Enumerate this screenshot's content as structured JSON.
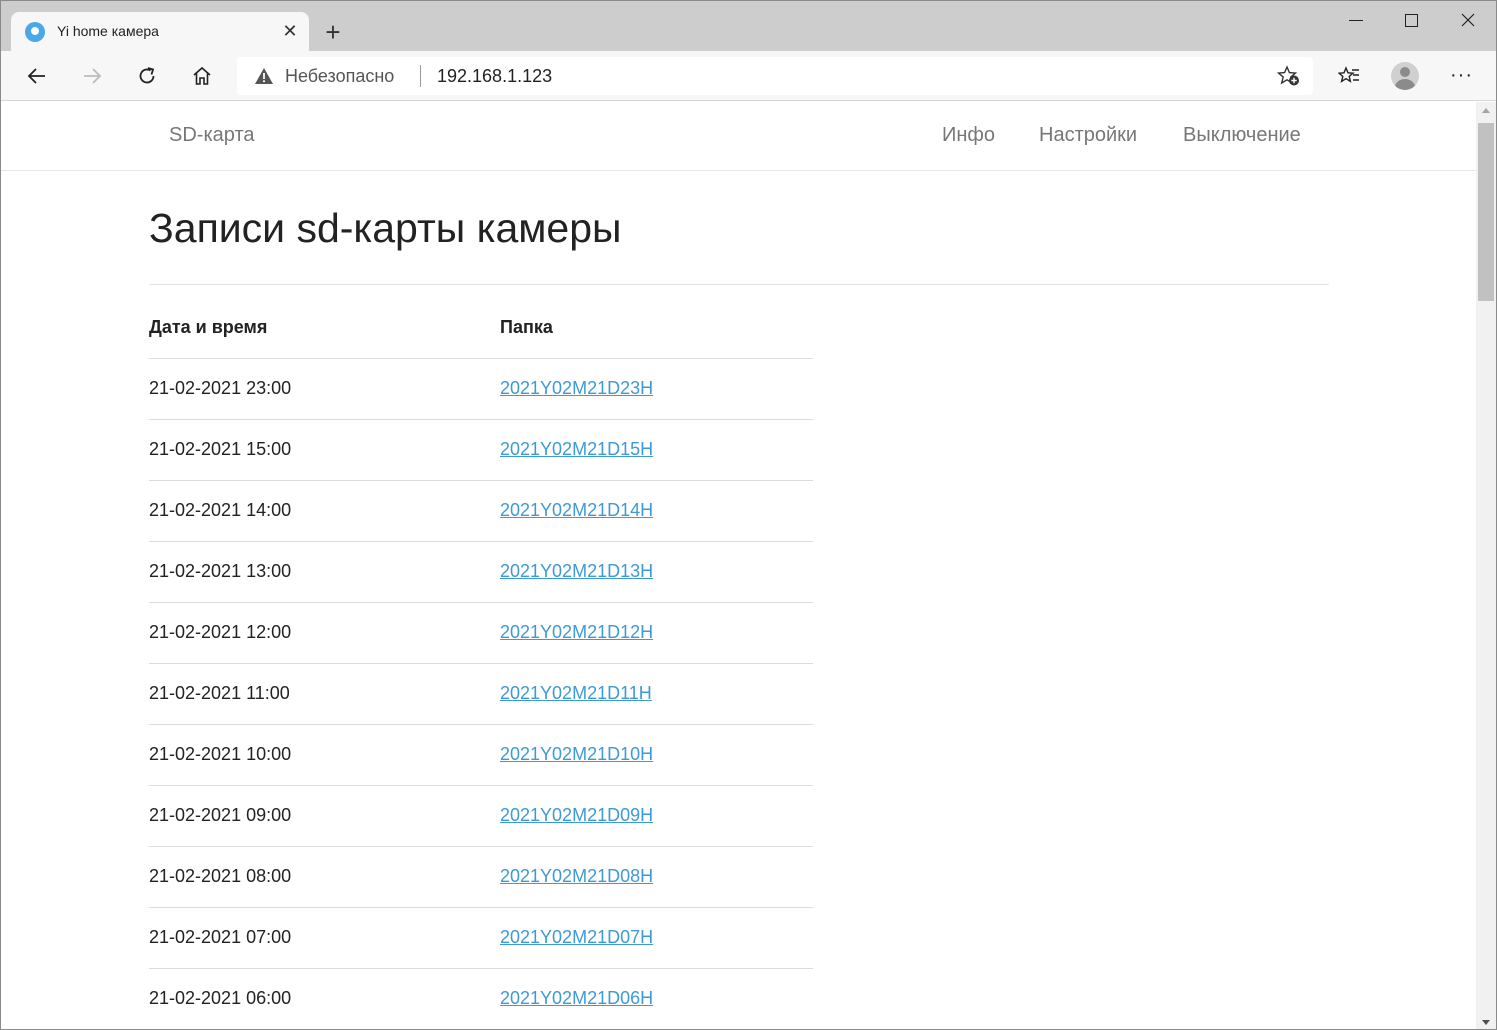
{
  "browser": {
    "tab_title": "Yi home камера",
    "security_label": "Небезопасно",
    "url": "192.168.1.123"
  },
  "site_nav": {
    "brand": "SD-карта",
    "links": [
      "Инфо",
      "Настройки",
      "Выключение"
    ]
  },
  "page": {
    "title": "Записи sd-карты камеры",
    "table": {
      "headers": [
        "Дата и время",
        "Папка"
      ],
      "rows": [
        {
          "datetime": "21-02-2021 23:00",
          "folder": "2021Y02M21D23H"
        },
        {
          "datetime": "21-02-2021 15:00",
          "folder": "2021Y02M21D15H"
        },
        {
          "datetime": "21-02-2021 14:00",
          "folder": "2021Y02M21D14H"
        },
        {
          "datetime": "21-02-2021 13:00",
          "folder": "2021Y02M21D13H"
        },
        {
          "datetime": "21-02-2021 12:00",
          "folder": "2021Y02M21D12H"
        },
        {
          "datetime": "21-02-2021 11:00",
          "folder": "2021Y02M21D11H"
        },
        {
          "datetime": "21-02-2021 10:00",
          "folder": "2021Y02M21D10H"
        },
        {
          "datetime": "21-02-2021 09:00",
          "folder": "2021Y02M21D09H"
        },
        {
          "datetime": "21-02-2021 08:00",
          "folder": "2021Y02M21D08H"
        },
        {
          "datetime": "21-02-2021 07:00",
          "folder": "2021Y02M21D07H"
        },
        {
          "datetime": "21-02-2021 06:00",
          "folder": "2021Y02M21D06H"
        }
      ]
    }
  },
  "colors": {
    "link": "#3e9ad6",
    "nav_text": "#777777",
    "tab_strip": "#cdcdcd"
  }
}
